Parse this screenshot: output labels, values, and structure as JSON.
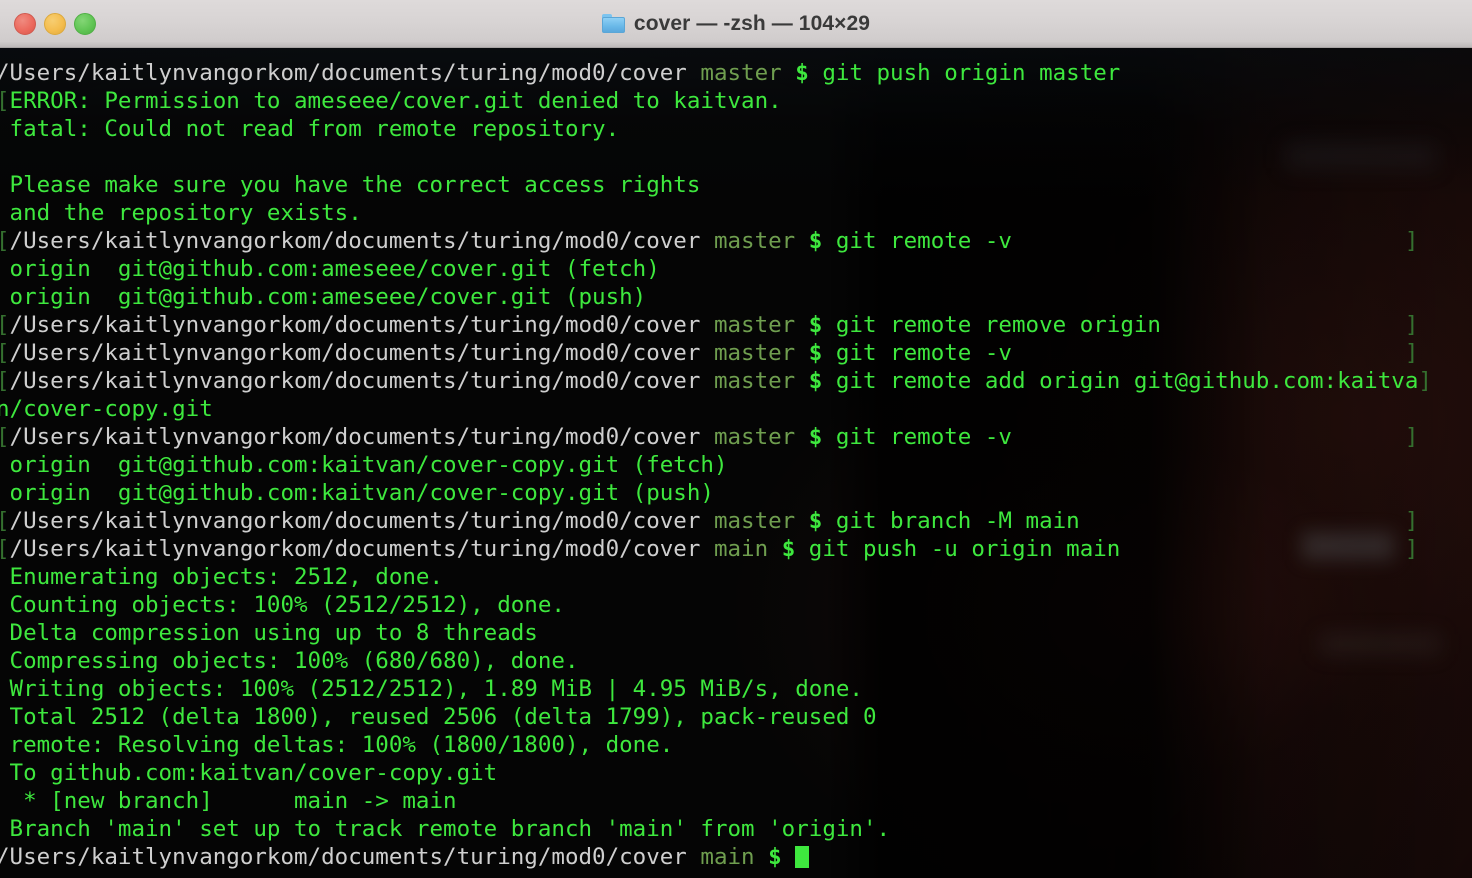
{
  "window": {
    "title": "cover — -zsh — 104×29",
    "folder_icon": "folder-icon",
    "traffic_lights": [
      {
        "name": "close-button",
        "color": "#ec6a5e"
      },
      {
        "name": "minimize-button",
        "color": "#f4bd4f"
      },
      {
        "name": "zoom-button",
        "color": "#61c555"
      }
    ],
    "titlebar_color": "#d5d1d1",
    "cols": 104,
    "rows": 29
  },
  "terminal": {
    "background": "#050505",
    "foreground": "#3ee83e",
    "path_color": "#cfcfcf",
    "branch_color": "#6f9e4f",
    "bracket_color": "#35702f",
    "cwd": "/Users/kaitlynvangorkom/documents/turing/mod0/cover",
    "prompt_symbol": "$",
    "cursor": "block",
    "lines": [
      {
        "type": "prompt",
        "bracket_open": "",
        "cwd": "/Users/kaitlynvangorkom/documents/turing/mod0/cover",
        "branch": "master",
        "symbol": "$",
        "command": "git push origin master",
        "bracket_close": ""
      },
      {
        "type": "output",
        "bracket_open": "[",
        "text": "ERROR: Permission to ameseee/cover.git denied to kaitvan."
      },
      {
        "type": "output",
        "text": " fatal: Could not read from remote repository."
      },
      {
        "type": "output",
        "text": ""
      },
      {
        "type": "output",
        "text": " Please make sure you have the correct access rights"
      },
      {
        "type": "output",
        "text": " and the repository exists."
      },
      {
        "type": "prompt",
        "bracket_open": "[",
        "cwd": "/Users/kaitlynvangorkom/documents/turing/mod0/cover",
        "branch": "master",
        "symbol": "$",
        "command": "git remote -v",
        "bracket_close": "]"
      },
      {
        "type": "output",
        "text": " origin  git@github.com:ameseee/cover.git (fetch)"
      },
      {
        "type": "output",
        "text": " origin  git@github.com:ameseee/cover.git (push)"
      },
      {
        "type": "prompt",
        "bracket_open": "[",
        "cwd": "/Users/kaitlynvangorkom/documents/turing/mod0/cover",
        "branch": "master",
        "symbol": "$",
        "command": "git remote remove origin",
        "bracket_close": "]"
      },
      {
        "type": "prompt",
        "bracket_open": "[",
        "cwd": "/Users/kaitlynvangorkom/documents/turing/mod0/cover",
        "branch": "master",
        "symbol": "$",
        "command": "git remote -v",
        "bracket_close": "]"
      },
      {
        "type": "prompt",
        "bracket_open": "[",
        "cwd": "/Users/kaitlynvangorkom/documents/turing/mod0/cover",
        "branch": "master",
        "symbol": "$",
        "command": "git remote add origin git@github.com:kaitva",
        "bracket_close": "]"
      },
      {
        "type": "output",
        "text": "n/cover-copy.git"
      },
      {
        "type": "prompt",
        "bracket_open": "[",
        "cwd": "/Users/kaitlynvangorkom/documents/turing/mod0/cover",
        "branch": "master",
        "symbol": "$",
        "command": "git remote -v",
        "bracket_close": "]"
      },
      {
        "type": "output",
        "text": " origin  git@github.com:kaitvan/cover-copy.git (fetch)"
      },
      {
        "type": "output",
        "text": " origin  git@github.com:kaitvan/cover-copy.git (push)"
      },
      {
        "type": "prompt",
        "bracket_open": "[",
        "cwd": "/Users/kaitlynvangorkom/documents/turing/mod0/cover",
        "branch": "master",
        "symbol": "$",
        "command": "git branch -M main",
        "bracket_close": "]"
      },
      {
        "type": "prompt",
        "bracket_open": "[",
        "cwd": "/Users/kaitlynvangorkom/documents/turing/mod0/cover",
        "branch": "main",
        "symbol": "$",
        "command": "git push -u origin main",
        "bracket_close": "]"
      },
      {
        "type": "output",
        "text": " Enumerating objects: 2512, done."
      },
      {
        "type": "output",
        "text": " Counting objects: 100% (2512/2512), done."
      },
      {
        "type": "output",
        "text": " Delta compression using up to 8 threads"
      },
      {
        "type": "output",
        "text": " Compressing objects: 100% (680/680), done."
      },
      {
        "type": "output",
        "text": " Writing objects: 100% (2512/2512), 1.89 MiB | 4.95 MiB/s, done."
      },
      {
        "type": "output",
        "text": " Total 2512 (delta 1800), reused 2506 (delta 1799), pack-reused 0"
      },
      {
        "type": "output",
        "text": " remote: Resolving deltas: 100% (1800/1800), done."
      },
      {
        "type": "output",
        "text": " To github.com:kaitvan/cover-copy.git"
      },
      {
        "type": "output",
        "text": "  * [new branch]      main -> main"
      },
      {
        "type": "output",
        "text": " Branch 'main' set up to track remote branch 'main' from 'origin'."
      },
      {
        "type": "prompt_active",
        "bracket_open": "",
        "cwd": "/Users/kaitlynvangorkom/documents/turing/mod0/cover",
        "branch": "main",
        "symbol": "$",
        "command": "",
        "bracket_close": ""
      }
    ]
  }
}
